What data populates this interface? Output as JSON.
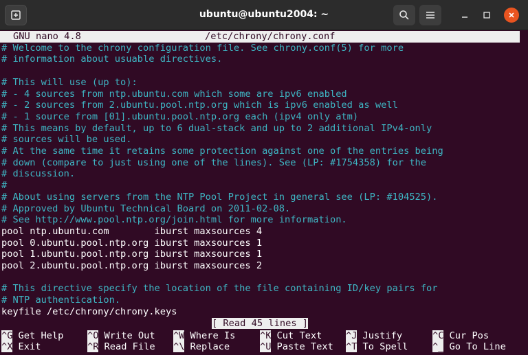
{
  "window": {
    "title": "ubuntu@ubuntu2004: ~"
  },
  "nano": {
    "app": "GNU nano 4.8",
    "filename": "/etc/chrony/chrony.conf",
    "lines": [
      {
        "type": "comment",
        "text": "# Welcome to the chrony configuration file. See chrony.conf(5) for more"
      },
      {
        "type": "comment",
        "text": "# information about usuable directives."
      },
      {
        "type": "comment",
        "text": ""
      },
      {
        "type": "comment",
        "text": "# This will use (up to):"
      },
      {
        "type": "comment",
        "text": "# - 4 sources from ntp.ubuntu.com which some are ipv6 enabled"
      },
      {
        "type": "comment",
        "text": "# - 2 sources from 2.ubuntu.pool.ntp.org which is ipv6 enabled as well"
      },
      {
        "type": "comment",
        "text": "# - 1 source from [01].ubuntu.pool.ntp.org each (ipv4 only atm)"
      },
      {
        "type": "comment",
        "text": "# This means by default, up to 6 dual-stack and up to 2 additional IPv4-only"
      },
      {
        "type": "comment",
        "text": "# sources will be used."
      },
      {
        "type": "comment",
        "text": "# At the same time it retains some protection against one of the entries being"
      },
      {
        "type": "comment",
        "text": "# down (compare to just using one of the lines). See (LP: #1754358) for the"
      },
      {
        "type": "comment",
        "text": "# discussion."
      },
      {
        "type": "comment",
        "text": "#"
      },
      {
        "type": "comment",
        "text": "# About using servers from the NTP Pool Project in general see (LP: #104525)."
      },
      {
        "type": "comment",
        "text": "# Approved by Ubuntu Technical Board on 2011-02-08."
      },
      {
        "type": "comment",
        "text": "# See http://www.pool.ntp.org/join.html for more information."
      },
      {
        "type": "code",
        "text": "pool ntp.ubuntu.com        iburst maxsources 4"
      },
      {
        "type": "code",
        "text": "pool 0.ubuntu.pool.ntp.org iburst maxsources 1"
      },
      {
        "type": "code",
        "text": "pool 1.ubuntu.pool.ntp.org iburst maxsources 1"
      },
      {
        "type": "code",
        "text": "pool 2.ubuntu.pool.ntp.org iburst maxsources 2"
      },
      {
        "type": "code",
        "text": ""
      },
      {
        "type": "comment",
        "text": "# This directive specify the location of the file containing ID/key pairs for"
      },
      {
        "type": "comment",
        "text": "# NTP authentication."
      },
      {
        "type": "code",
        "text": "keyfile /etc/chrony/chrony.keys"
      }
    ],
    "status": "[ Read 45 lines ]",
    "shortcuts": [
      {
        "key": "^G",
        "label": "Get Help"
      },
      {
        "key": "^O",
        "label": "Write Out"
      },
      {
        "key": "^W",
        "label": "Where Is"
      },
      {
        "key": "^K",
        "label": "Cut Text"
      },
      {
        "key": "^J",
        "label": "Justify"
      },
      {
        "key": "^C",
        "label": "Cur Pos"
      },
      {
        "key": "^X",
        "label": "Exit"
      },
      {
        "key": "^R",
        "label": "Read File"
      },
      {
        "key": "^\\",
        "label": "Replace"
      },
      {
        "key": "^U",
        "label": "Paste Text"
      },
      {
        "key": "^T",
        "label": "To Spell"
      },
      {
        "key": "^_",
        "label": "Go To Line"
      }
    ]
  },
  "icons": {
    "new_tab": "new-tab-icon",
    "search": "search-icon",
    "menu": "hamburger-menu-icon",
    "minimize": "minimize-icon",
    "maximize": "maximize-icon",
    "close": "close-icon"
  },
  "colors": {
    "terminal_bg": "#300a24",
    "comment": "#3eb6c4",
    "text": "#ffffff",
    "bar_bg": "#eeeeee",
    "close_button": "#e95420"
  }
}
